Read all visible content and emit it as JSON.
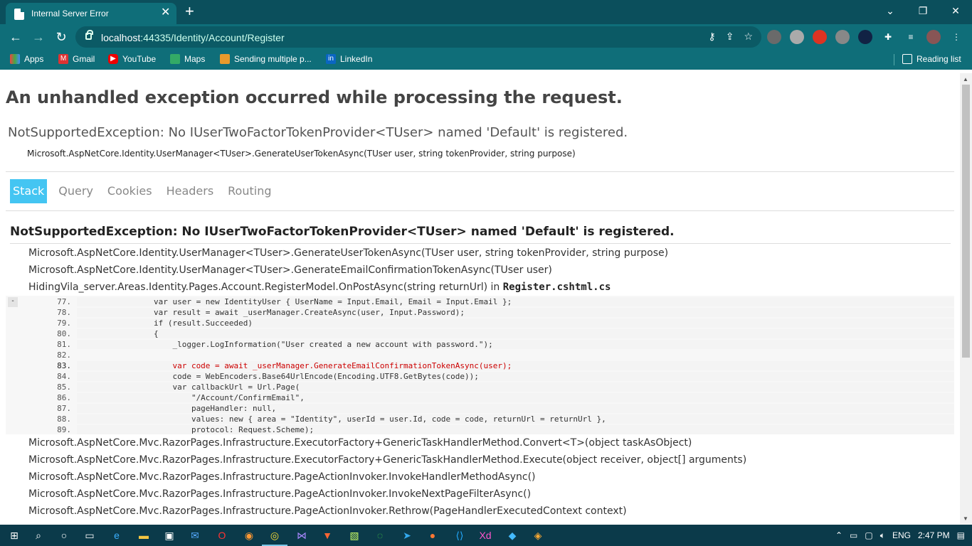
{
  "browser": {
    "tab_title": "Internal Server Error",
    "tab_close": "✕",
    "new_tab": "+",
    "window_controls": {
      "minimize": "⌄",
      "restore": "❐",
      "close": "✕"
    },
    "nav": {
      "back": "←",
      "forward": "→",
      "reload": "↻"
    },
    "url_host": "localhost",
    "url_rest": ":44335/Identity/Account/Register",
    "bookmarks": [
      {
        "label": "Apps",
        "icon": "apps-grid-icon"
      },
      {
        "label": "Gmail",
        "icon": "gmail-icon"
      },
      {
        "label": "YouTube",
        "icon": "youtube-icon"
      },
      {
        "label": "Maps",
        "icon": "maps-icon"
      },
      {
        "label": "Sending multiple p...",
        "icon": "stack-icon"
      },
      {
        "label": "LinkedIn",
        "icon": "linkedin-icon"
      }
    ],
    "reading_list": "Reading list"
  },
  "page": {
    "heading": "An unhandled exception occurred while processing the request.",
    "exception_title": "NotSupportedException: No IUserTwoFactorTokenProvider<TUser> named 'Default' is registered.",
    "exception_location": "Microsoft.AspNetCore.Identity.UserManager<TUser>.GenerateUserTokenAsync(TUser user, string tokenProvider, string purpose)",
    "tabs": [
      "Stack",
      "Query",
      "Cookies",
      "Headers",
      "Routing"
    ],
    "stack_heading": "NotSupportedException: No IUserTwoFactorTokenProvider<TUser> named 'Default' is registered.",
    "frames_top": [
      "Microsoft.AspNetCore.Identity.UserManager<TUser>.GenerateUserTokenAsync(TUser user, string tokenProvider, string purpose)",
      "Microsoft.AspNetCore.Identity.UserManager<TUser>.GenerateEmailConfirmationTokenAsync(TUser user)"
    ],
    "frame_source": {
      "text": "HidingVila_server.Areas.Identity.Pages.Account.RegisterModel.OnPostAsync(string returnUrl) in ",
      "file": "Register.cshtml.cs"
    },
    "code_toggle": "-",
    "code_lines": [
      {
        "num": "77.",
        "code": "                var user = new IdentityUser { UserName = Input.Email, Email = Input.Email };"
      },
      {
        "num": "78.",
        "code": "                var result = await _userManager.CreateAsync(user, Input.Password);"
      },
      {
        "num": "79.",
        "code": "                if (result.Succeeded)"
      },
      {
        "num": "80.",
        "code": "                {"
      },
      {
        "num": "81.",
        "code": "                    _logger.LogInformation(\"User created a new account with password.\");"
      },
      {
        "num": "82.",
        "code": ""
      },
      {
        "num": "83.",
        "code": "                    var code = await _userManager.GenerateEmailConfirmationTokenAsync(user);"
      },
      {
        "num": "84.",
        "code": "                    code = WebEncoders.Base64UrlEncode(Encoding.UTF8.GetBytes(code));"
      },
      {
        "num": "85.",
        "code": "                    var callbackUrl = Url.Page("
      },
      {
        "num": "86.",
        "code": "                        \"/Account/ConfirmEmail\","
      },
      {
        "num": "87.",
        "code": "                        pageHandler: null,"
      },
      {
        "num": "88.",
        "code": "                        values: new { area = \"Identity\", userId = user.Id, code = code, returnUrl = returnUrl },"
      },
      {
        "num": "89.",
        "code": "                        protocol: Request.Scheme);"
      }
    ],
    "frames_bottom": [
      "Microsoft.AspNetCore.Mvc.RazorPages.Infrastructure.ExecutorFactory+GenericTaskHandlerMethod.Convert<T>(object taskAsObject)",
      "Microsoft.AspNetCore.Mvc.RazorPages.Infrastructure.ExecutorFactory+GenericTaskHandlerMethod.Execute(object receiver, object[] arguments)",
      "Microsoft.AspNetCore.Mvc.RazorPages.Infrastructure.PageActionInvoker.InvokeHandlerMethodAsync()",
      "Microsoft.AspNetCore.Mvc.RazorPages.Infrastructure.PageActionInvoker.InvokeNextPageFilterAsync()",
      "Microsoft.AspNetCore.Mvc.RazorPages.Infrastructure.PageActionInvoker.Rethrow(PageHandlerExecutedContext context)"
    ]
  },
  "taskbar": {
    "language": "ENG",
    "time": "2:47 PM"
  },
  "colors": {
    "tab_active": "#44c5f2",
    "highlight_line": "#cc0000",
    "browser_frame": "#0f6e79"
  }
}
